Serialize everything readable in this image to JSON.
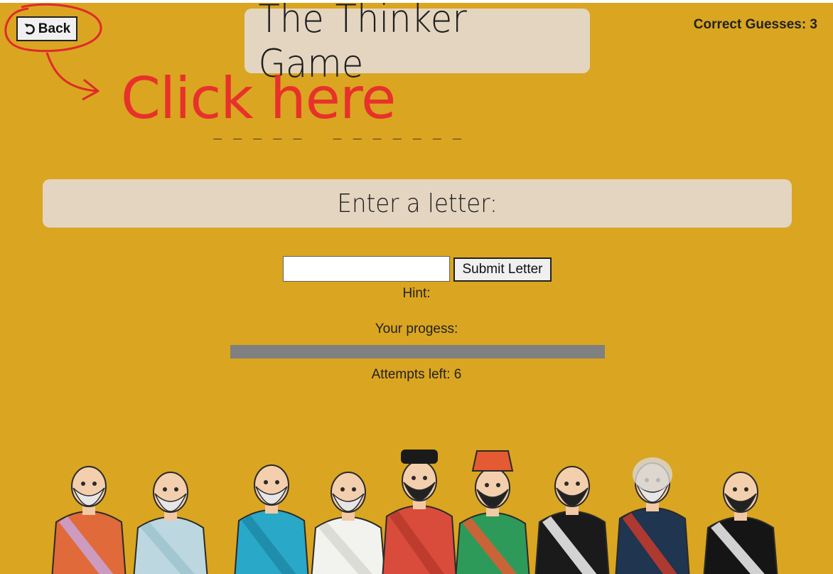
{
  "header": {
    "back_label": "Back",
    "title": "The Thinker Game",
    "correct_guesses": "Correct Guesses: 3"
  },
  "annotation": {
    "text": "Click here"
  },
  "word": {
    "blanks": "_ _ _ _ _   _ _ _ _ _ _ _"
  },
  "prompt": {
    "label": "Enter a letter:"
  },
  "form": {
    "input_value": "",
    "input_placeholder": "",
    "submit_label": "Submit Letter"
  },
  "hint": {
    "label": "Hint:"
  },
  "progress": {
    "label": "Your progess:",
    "value": 0
  },
  "attempts": {
    "label": "Attempts left: 6"
  },
  "figures": [
    {
      "name": "socrates",
      "robe": "#e06a3a",
      "sash": "#c9a2d8"
    },
    {
      "name": "plato",
      "robe": "#bcd7df",
      "sash": "#9fc4cf"
    },
    {
      "name": "aristotle",
      "robe": "#2aa8c8",
      "sash": "#1d89a8"
    },
    {
      "name": "laozi",
      "robe": "#f2f2ee",
      "sash": "#d8d8d2"
    },
    {
      "name": "confucius",
      "robe": "#d94b3a",
      "sash": "#b83a2c"
    },
    {
      "name": "sun-tzu",
      "robe": "#2e9a5a",
      "sash": "#e45a32"
    },
    {
      "name": "nietzsche",
      "robe": "#1a1a1a",
      "sash": "#f5f5f5"
    },
    {
      "name": "voltaire",
      "robe": "#1f3550",
      "sash": "#c83a2a"
    },
    {
      "name": "descartes",
      "robe": "#151515",
      "sash": "#f2f2f2"
    }
  ],
  "colors": {
    "background": "#daa520",
    "panel": "#e4d5c0",
    "annotation": "#e8312b",
    "progress_track": "#808080"
  }
}
